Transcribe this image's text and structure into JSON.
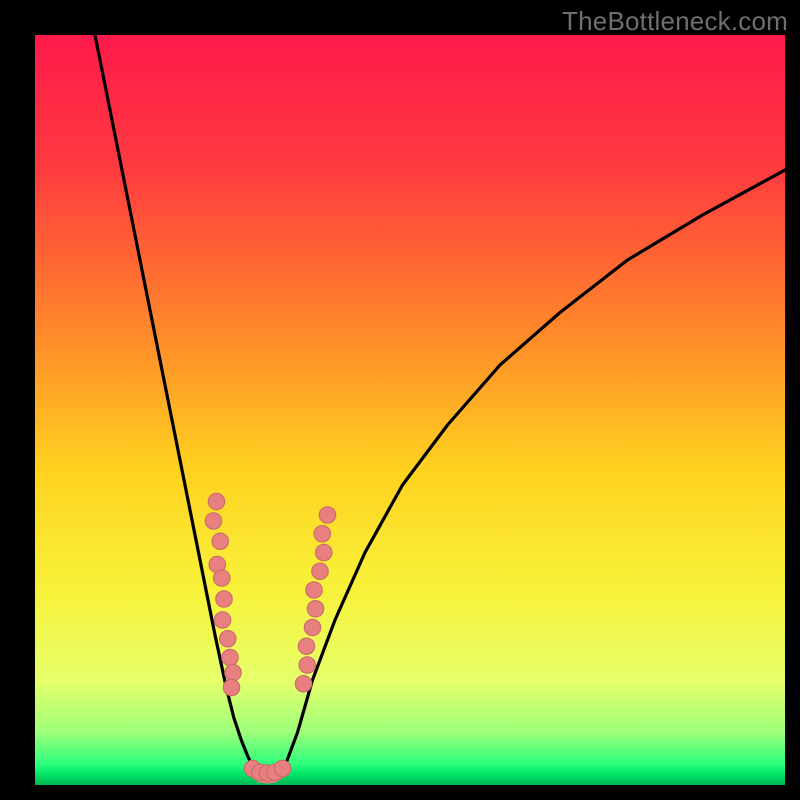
{
  "watermark": "TheBottleneck.com",
  "gradient_stops": [
    {
      "offset": 0.0,
      "color": "#ff1a4b"
    },
    {
      "offset": 0.18,
      "color": "#ff3b3f"
    },
    {
      "offset": 0.4,
      "color": "#ff8a2a"
    },
    {
      "offset": 0.58,
      "color": "#ffd21f"
    },
    {
      "offset": 0.74,
      "color": "#f8f23a"
    },
    {
      "offset": 0.86,
      "color": "#e7ff6a"
    },
    {
      "offset": 0.93,
      "color": "#9dff7a"
    },
    {
      "offset": 0.972,
      "color": "#2cff7c"
    },
    {
      "offset": 0.985,
      "color": "#00e76a"
    },
    {
      "offset": 1.0,
      "color": "#00b74f"
    }
  ],
  "curve_color": "#000000",
  "points_fill": "#e98080",
  "points_stroke": "#c96c6c",
  "chart_data": {
    "type": "line",
    "title": "",
    "xlabel": "",
    "ylabel": "",
    "xlim": [
      0,
      100
    ],
    "ylim": [
      0,
      100
    ],
    "series": [
      {
        "name": "left-branch",
        "x": [
          8,
          10,
          12,
          14,
          16,
          18,
          20,
          22,
          24,
          25.5,
          26.5,
          27.5,
          28.3,
          29.0,
          29.5
        ],
        "y": [
          100,
          90,
          80,
          70,
          60,
          50,
          40,
          30,
          20,
          13,
          9,
          6,
          4,
          2.5,
          1.5
        ]
      },
      {
        "name": "right-branch",
        "x": [
          32.5,
          33.5,
          35,
          37,
          40,
          44,
          49,
          55,
          62,
          70,
          79,
          89,
          100
        ],
        "y": [
          1.5,
          3,
          7,
          14,
          22,
          31,
          40,
          48,
          56,
          63,
          70,
          76,
          82
        ]
      },
      {
        "name": "bottom-connector",
        "x": [
          29.5,
          30.2,
          31.0,
          31.8,
          32.5
        ],
        "y": [
          1.5,
          1.1,
          1.0,
          1.1,
          1.5
        ]
      }
    ],
    "scatter": [
      {
        "name": "left-cluster",
        "points": [
          [
            24.2,
            37.8
          ],
          [
            23.8,
            35.2
          ],
          [
            24.7,
            32.5
          ],
          [
            24.3,
            29.4
          ],
          [
            24.9,
            27.6
          ],
          [
            25.2,
            24.8
          ],
          [
            25.0,
            22.0
          ],
          [
            25.7,
            19.5
          ],
          [
            26.0,
            17.0
          ],
          [
            26.4,
            15.0
          ],
          [
            26.2,
            13.0
          ]
        ]
      },
      {
        "name": "right-cluster",
        "points": [
          [
            35.8,
            13.5
          ],
          [
            36.3,
            16.0
          ],
          [
            36.2,
            18.5
          ],
          [
            37.0,
            21.0
          ],
          [
            37.4,
            23.5
          ],
          [
            37.2,
            26.0
          ],
          [
            38.0,
            28.5
          ],
          [
            38.5,
            31.0
          ],
          [
            38.3,
            33.5
          ],
          [
            39.0,
            36.0
          ]
        ]
      },
      {
        "name": "bottom-cluster",
        "points": [
          [
            29.0,
            2.2
          ],
          [
            30.0,
            1.7
          ],
          [
            31.0,
            1.6
          ],
          [
            32.0,
            1.7
          ],
          [
            33.0,
            2.2
          ]
        ]
      }
    ],
    "point_radius_pct": 1.1
  }
}
